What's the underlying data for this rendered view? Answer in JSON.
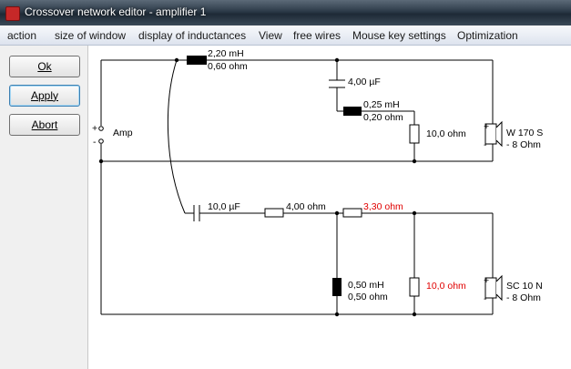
{
  "window": {
    "title": "Crossover network editor - amplifier 1"
  },
  "menu": [
    "action",
    "size of window",
    "display of inductances",
    "View",
    "free wires",
    "Mouse key settings",
    "Optimization"
  ],
  "buttons": {
    "ok": "Ok",
    "apply": "Apply",
    "abort": "Abort"
  },
  "circuit": {
    "amp_label": "Amp",
    "amp_plus": "+",
    "amp_minus": "-",
    "inductor1": [
      "2,20 mH",
      "0,60 ohm"
    ],
    "capacitor1": "4,00 µF",
    "inductor2": [
      "0,25 mH",
      "0,20 ohm"
    ],
    "resistor_woofer": "10,0 ohm",
    "woofer": [
      "W 170 S",
      "- 8 Ohm"
    ],
    "capacitor2": "10,0 µF",
    "resistor_series1": "4,00 ohm",
    "resistor_series2": "3,30 ohm",
    "inductor3": [
      "0,50 mH",
      "0,50 ohm"
    ],
    "resistor_tweeter": "10,0 ohm",
    "tweeter": [
      "SC 10 N",
      "- 8 Ohm"
    ],
    "speaker_plus": "+",
    "speaker_minus": "-"
  },
  "colors": {
    "highlight_values": "#e00000",
    "wire": "#000000"
  }
}
